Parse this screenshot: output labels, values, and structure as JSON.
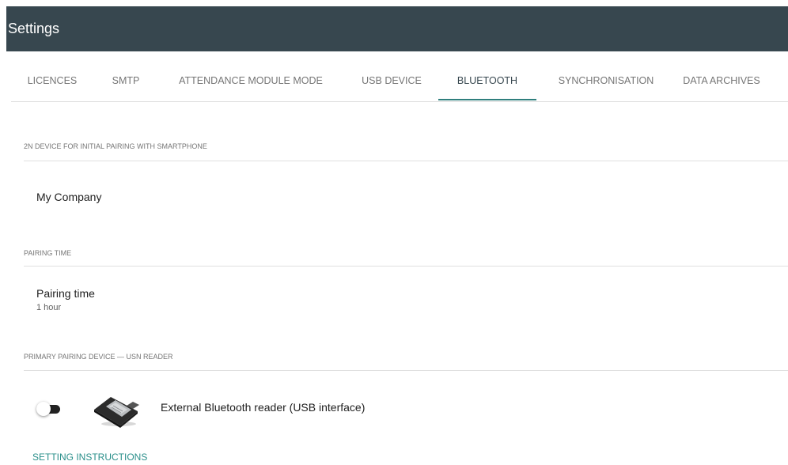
{
  "header": {
    "title": "Settings"
  },
  "tabs": [
    {
      "label": "LICENCES",
      "active": false
    },
    {
      "label": "SMTP",
      "active": false
    },
    {
      "label": "ATTENDANCE MODULE MODE",
      "active": false
    },
    {
      "label": "USB DEVICE",
      "active": false
    },
    {
      "label": "BLUETOOTH",
      "active": true
    },
    {
      "label": "SYNCHRONISATION",
      "active": false
    },
    {
      "label": "DATA ARCHIVES",
      "active": false
    }
  ],
  "sections": {
    "device": {
      "label": "2N DEVICE FOR INITIAL PAIRING WITH SMARTPHONE",
      "value": "My Company"
    },
    "pairing_time": {
      "label": "PAIRING TIME",
      "title": "Pairing time",
      "value": "1 hour"
    },
    "primary_device": {
      "label": "PRIMARY PAIRING DEVICE — USN READER",
      "toggle_on": false,
      "reader_label": "External Bluetooth reader (USB interface)",
      "reader_icon": "usb-bluetooth-reader-image"
    }
  },
  "links": {
    "instructions": "SETTING INSTRUCTIONS"
  },
  "colors": {
    "header_bg": "#37474f",
    "accent": "#2f7f7d",
    "link": "#2a8f8a"
  }
}
